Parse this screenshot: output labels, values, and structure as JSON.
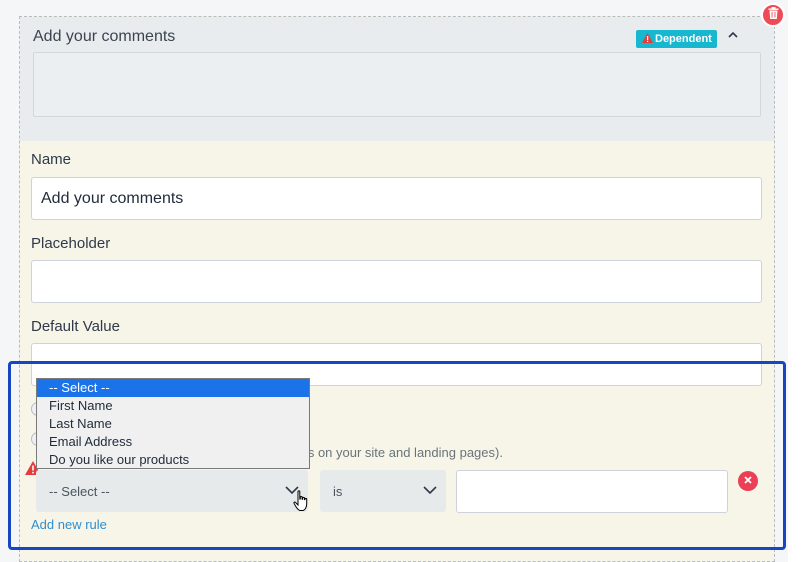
{
  "field": {
    "preview_title": "Add your comments",
    "badge_label": "Dependent",
    "name_label": "Name",
    "name_value": "Add your comments",
    "placeholder_label": "Placeholder",
    "placeholder_value": "",
    "default_label": "Default Value",
    "default_value": ""
  },
  "rules": {
    "visibility_note_fragment": "ms on your site and landing pages).",
    "field_select_value": "-- Select --",
    "operator_select_value": "is",
    "rule_value": "",
    "add_rule_label": "Add new rule"
  },
  "dropdown": {
    "options": [
      {
        "label": "-- Select --",
        "selected": true
      },
      {
        "label": "First Name",
        "selected": false
      },
      {
        "label": "Last Name",
        "selected": false
      },
      {
        "label": "Email Address",
        "selected": false
      },
      {
        "label": "Do you like our products",
        "selected": false
      }
    ]
  },
  "colors": {
    "badge": "#16b7cf",
    "highlight_border": "#1647c0",
    "danger": "#ee4b57",
    "link": "#2e8fd0",
    "selected_option": "#1a73e8"
  }
}
